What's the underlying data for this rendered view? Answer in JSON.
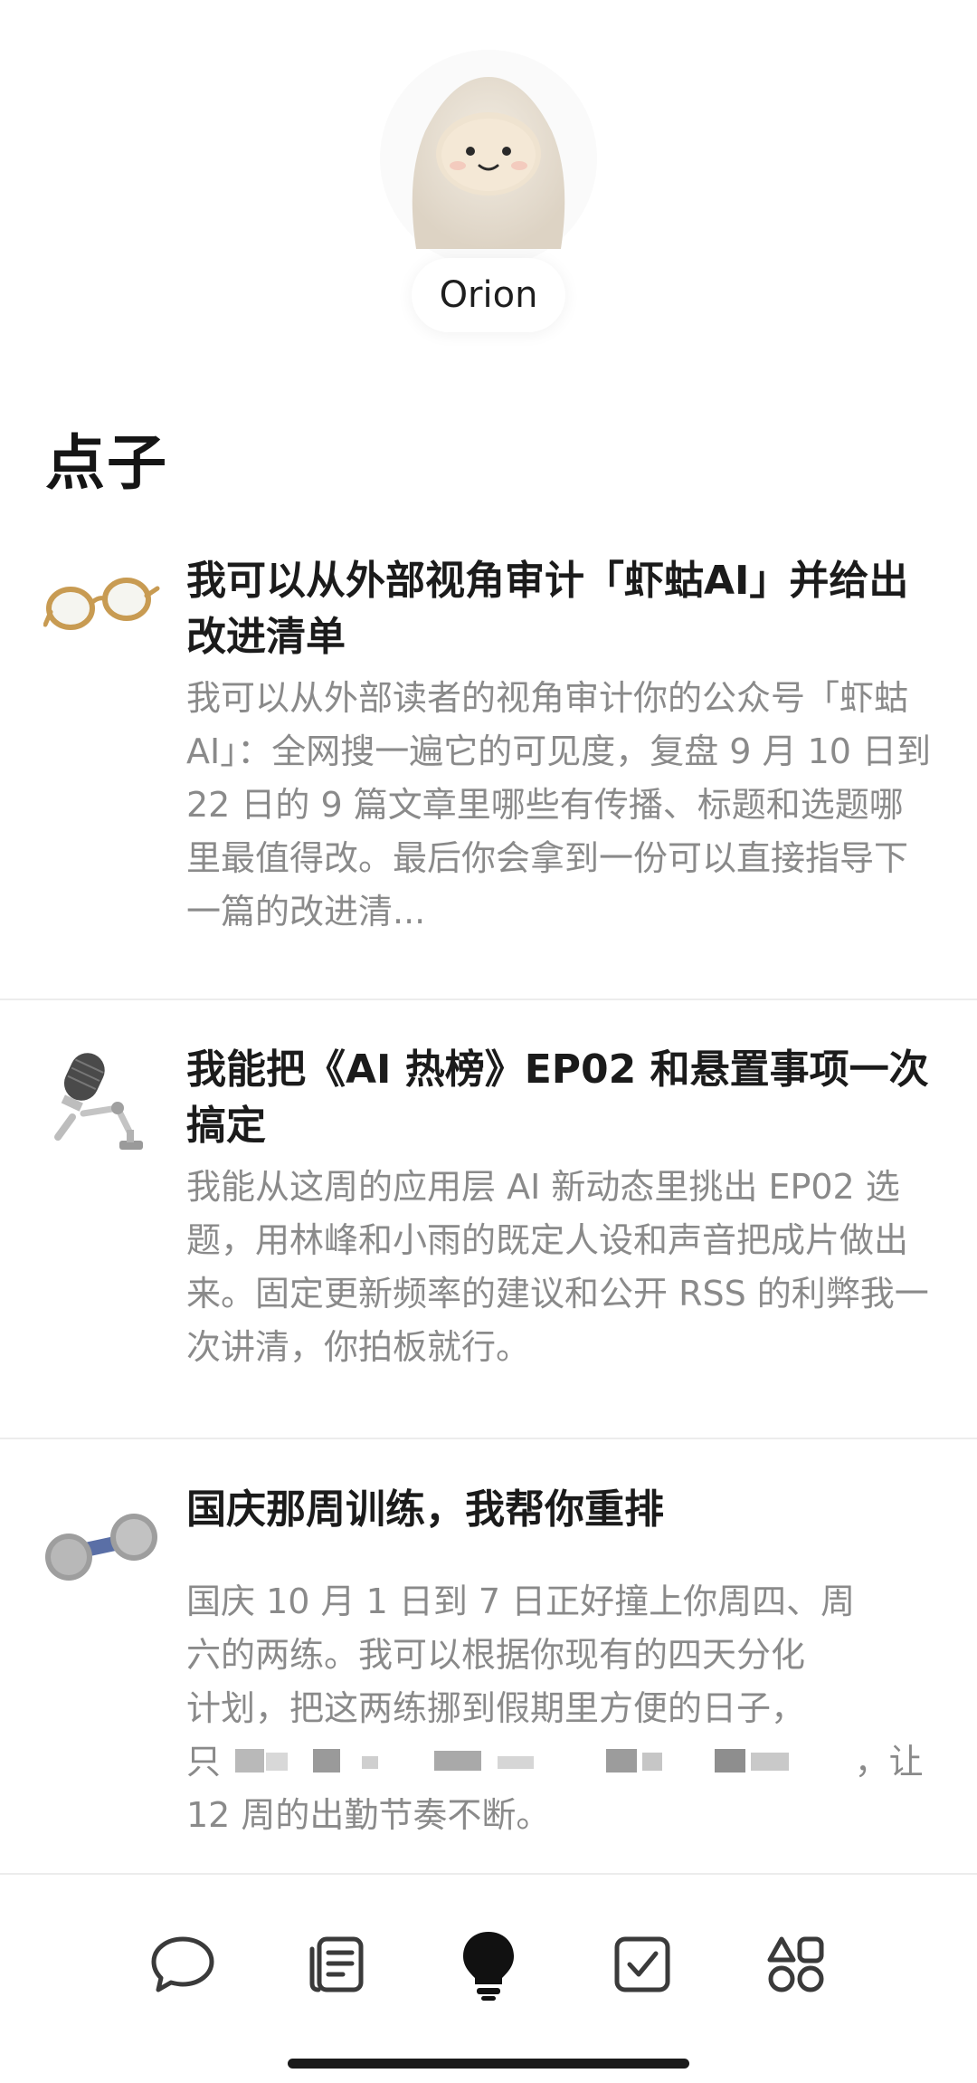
{
  "profile": {
    "name": "Orion"
  },
  "section": {
    "title": "点子"
  },
  "ideas": [
    {
      "icon": "glasses-icon",
      "title": "我可以从外部视角审计「虾蛄AI」并给出改进清单",
      "body": "我可以从外部读者的视角审计你的公众号「虾蛄AI」：全网搜一遍它的可见度，复盘 9 月 10 日到 22 日的 9 篇文章里哪些有传播、标题和选题哪里最值得改。最后你会拿到一份可以直接指导下一篇的改进清..."
    },
    {
      "icon": "microphone-icon",
      "title": "我能把《AI 热榜》EP02 和悬置事项一次搞定",
      "body": "我能从这周的应用层 AI 新动态里挑出 EP02 选题，用林峰和小雨的既定人设和声音把成片做出来。固定更新频率的建议和公开 RSS 的利弊我一次讲清，你拍板就行。"
    },
    {
      "icon": "dumbbell-icon",
      "title": "国庆那周训练，我帮你重排",
      "body_lines": [
        "国庆 10 月 1 日到 7 日正好撞上你周四、周",
        "六的两练。我可以根据你现有的四天分化",
        "计划，把这两练挪到假期里方便的日子，",
        "只                                                          ，让",
        "12 周的出勤节奏不断。"
      ]
    }
  ],
  "tabbar": {
    "tabs": [
      {
        "name": "chat",
        "icon": "chat-bubble-icon",
        "active": false
      },
      {
        "name": "notes",
        "icon": "notes-icon",
        "active": false
      },
      {
        "name": "ideas",
        "icon": "lightbulb-icon",
        "active": true
      },
      {
        "name": "tasks",
        "icon": "checkbox-icon",
        "active": false
      },
      {
        "name": "more",
        "icon": "shapes-icon",
        "active": false
      }
    ]
  },
  "colors": {
    "title_text": "#1b1b1b",
    "body_text": "#8a8a8a",
    "divider": "#ececec",
    "icon_gray": "#3a3a3a"
  }
}
